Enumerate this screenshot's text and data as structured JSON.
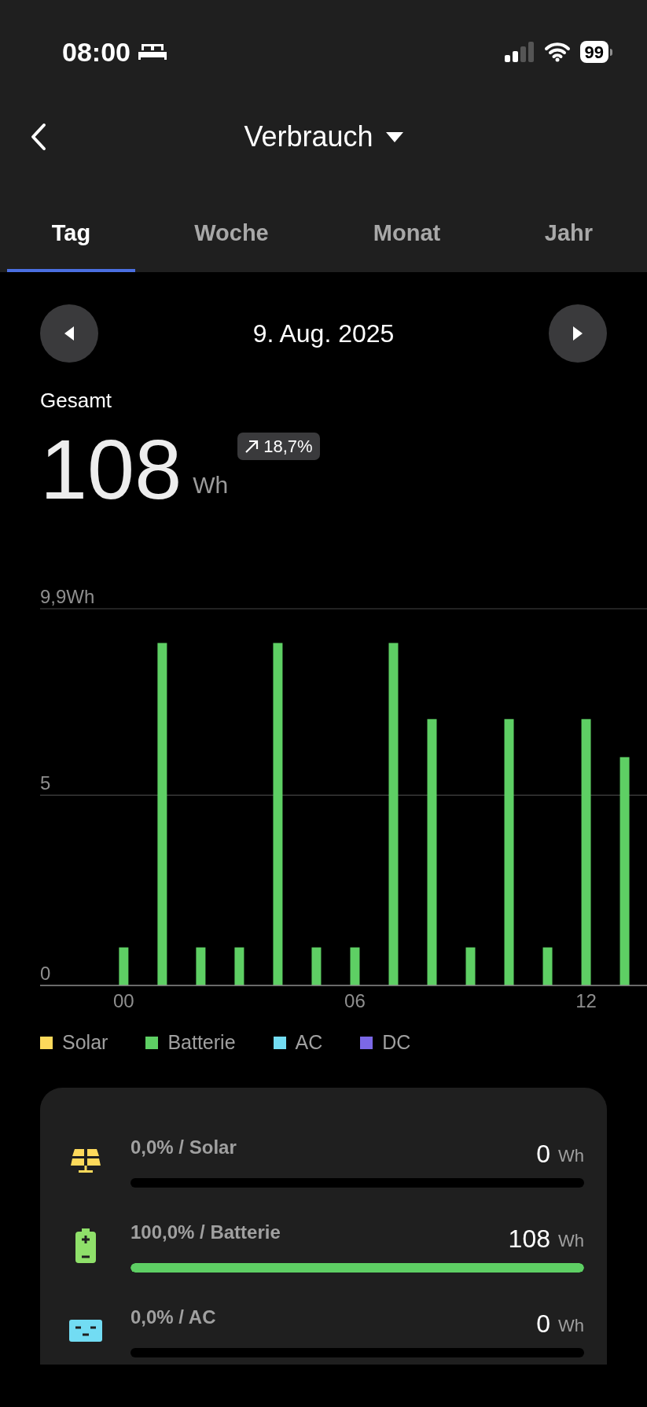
{
  "status_bar": {
    "time": "08:00",
    "battery": "99"
  },
  "header": {
    "title": "Verbrauch"
  },
  "tabs": [
    {
      "label": "Tag",
      "selected": true
    },
    {
      "label": "Woche",
      "selected": false
    },
    {
      "label": "Monat",
      "selected": false
    },
    {
      "label": "Jahr",
      "selected": false
    }
  ],
  "date": "9. Aug. 2025",
  "total": {
    "label": "Gesamt",
    "value": "108",
    "unit": "Wh",
    "change": "18,7%"
  },
  "chart_data": {
    "type": "bar",
    "x": [
      0,
      1,
      2,
      3,
      4,
      5,
      6,
      7,
      8,
      9,
      10,
      11,
      12,
      13
    ],
    "series": [
      {
        "name": "Solar",
        "color": "#fcd95b",
        "values": [
          null,
          null,
          null,
          null,
          null,
          null,
          null,
          null,
          null,
          null,
          null,
          null,
          null,
          null
        ]
      },
      {
        "name": "Batterie",
        "color": "#5ecf64",
        "values": [
          1,
          9,
          1,
          1,
          9,
          1,
          1,
          9,
          7,
          1,
          7,
          1,
          7,
          6
        ]
      },
      {
        "name": "AC",
        "color": "#72dcf3",
        "values": [
          null,
          null,
          null,
          null,
          null,
          null,
          null,
          null,
          null,
          null,
          null,
          null,
          null,
          null
        ]
      },
      {
        "name": "DC",
        "color": "#7b68e6",
        "values": [
          null,
          null,
          null,
          null,
          null,
          null,
          null,
          null,
          null,
          null,
          null,
          null,
          null,
          null
        ]
      }
    ],
    "xlim": [
      -2.17,
      13.58
    ],
    "ylim": [
      0,
      9.9
    ],
    "yticks": [
      {
        "value": 0,
        "label": "0"
      },
      {
        "value": 5,
        "label": "5"
      },
      {
        "value": 9.9,
        "label": "9,9Wh"
      }
    ],
    "xticks": [
      {
        "value": 0,
        "label": "00"
      },
      {
        "value": 6,
        "label": "06"
      },
      {
        "value": 12,
        "label": "12"
      }
    ]
  },
  "sources": [
    {
      "kind": "solar",
      "label": "0,0% / Solar",
      "value": "0",
      "unit": "Wh",
      "level": 0
    },
    {
      "kind": "battery",
      "label": "100,0% / Batterie",
      "value": "108",
      "unit": "Wh",
      "level": 1
    },
    {
      "kind": "ac",
      "label": "0,0% / AC",
      "value": "0",
      "unit": "Wh",
      "level": 0
    }
  ]
}
